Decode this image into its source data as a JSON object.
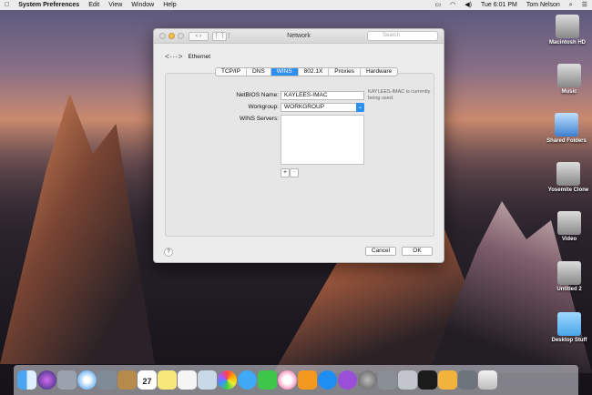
{
  "menubar": {
    "app": "System Preferences",
    "menus": [
      "Edit",
      "View",
      "Window",
      "Help"
    ],
    "clock": "Tue 6:01 PM",
    "user": "Tom Nelson"
  },
  "window": {
    "title": "Network",
    "search_placeholder": "Search",
    "interface": "Ethernet",
    "tabs": [
      "TCP/IP",
      "DNS",
      "WINS",
      "802.1X",
      "Proxies",
      "Hardware"
    ],
    "active_tab": "WINS",
    "netbios_label": "NetBIOS Name:",
    "netbios_value": "KAYLEES-IMAC",
    "netbios_note": "KAYLEES-IMAC is currently being used.",
    "workgroup_label": "Workgroup:",
    "workgroup_value": "WORKGROUP",
    "wins_label": "WINS Servers:",
    "add": "+",
    "remove": "−",
    "help": "?",
    "cancel": "Cancel",
    "ok": "OK"
  },
  "desktop": [
    "Macintosh HD",
    "Music",
    "Shared Folders",
    "Yosemite Clone",
    "Video",
    "Untitled 2",
    "Desktop Stuff"
  ],
  "dock": [
    "Finder",
    "Siri",
    "Launchpad",
    "Safari",
    "Photo Browser",
    "Notes Book",
    "Calendar",
    "Stickies",
    "Reminders",
    "Preview",
    "Photos",
    "Messages",
    "FaceTime",
    "iTunes",
    "iBooks",
    "App Store",
    "Podcast",
    "System Preferences",
    "Utility",
    "Migration",
    "Terminal",
    "Archive",
    "Grab",
    "Trash"
  ],
  "calendar_day": "27"
}
